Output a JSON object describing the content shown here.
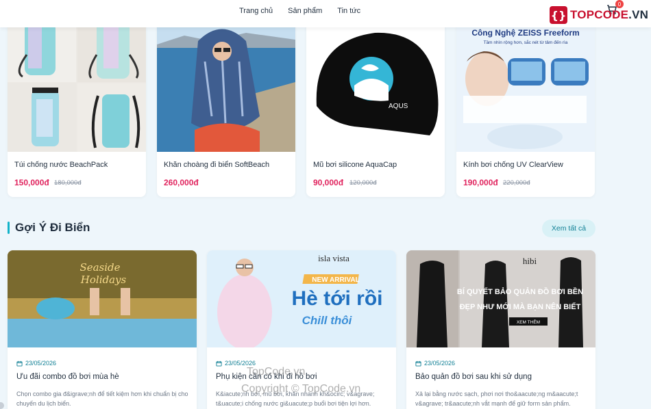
{
  "header": {
    "nav": [
      "Trang chủ",
      "Sản phẩm",
      "Tin tức"
    ],
    "logo_text": "TOPCODE",
    "logo_suffix": ".VN",
    "cart_count": "0"
  },
  "products": [
    {
      "name": "Túi chống nước BeachPack",
      "price": "150,000đ",
      "old_price": "180,000đ",
      "tag_color": "#22c55e"
    },
    {
      "name": "Khăn choàng đi biển SoftBeach",
      "price": "260,000đ",
      "old_price": "",
      "tag_color": "#22c55e"
    },
    {
      "name": "Mũ bơi silicone AquaCap",
      "price": "90,000đ",
      "old_price": "120,000đ",
      "tag_color": "#22c55e"
    },
    {
      "name": "Kính bơi chống UV ClearView",
      "price": "190,000đ",
      "old_price": "220,000đ",
      "tag_color": "#22c55e"
    }
  ],
  "product_images": {
    "cap_brand": "AQUS",
    "zeiss_title": "Công Nghệ ZEISS Freeform",
    "zeiss_sub": "Tầm nhìn rộng hơn, sắc nét từ tâm đến rìa"
  },
  "section": {
    "title": "Gợi Ý Đi Biển",
    "see_all": "Xem tất cả"
  },
  "blogs": [
    {
      "date": "23/05/2026",
      "title": "Ưu đãi combo đồ bơi mùa hè",
      "excerpt": "Chọn combo gia đ&igrave;nh để tiết kiệm hơn khi chuẩn bị cho chuyến du lịch biển.",
      "img_text1": "Seaside",
      "img_text2": "Holidays"
    },
    {
      "date": "23/05/2026",
      "title": "Phụ kiện cần có khi đi hồ bơi",
      "excerpt": "K&iacute;nh bơi, mũ bơi, khăn nhanh kh&ocirc; v&agrave; t&uacute;i chống nước gi&uacute;p buổi bơi tiện lợi hơn.",
      "img_brand": "isla vista",
      "img_badge": "NEW ARRIVAL",
      "img_head": "Hè tới rồi",
      "img_sub": "Chill thôi"
    },
    {
      "date": "23/05/2026",
      "title": "Bảo quản đồ bơi sau khi sử dụng",
      "excerpt": "Xả lại bằng nước sạch, phơi nơi tho&aacute;ng m&aacute;t v&agrave; tr&aacute;nh vắt mạnh để giữ form sản phẩm.",
      "img_brand": "hibi",
      "img_head1": "BÍ QUYẾT BẢO QUẢN ĐỒ BƠI BỀN",
      "img_head2": "ĐẸP NHƯ MỚI MÀ BẠN NÊN BIẾT",
      "img_btn": "XEM THÊM"
    }
  ],
  "watermarks": [
    "TopCode.vn",
    "Copyright © TopCode.vn"
  ],
  "colors": {
    "accent": "#12b3c9",
    "price": "#e0245e",
    "brand": "#c8102e"
  }
}
